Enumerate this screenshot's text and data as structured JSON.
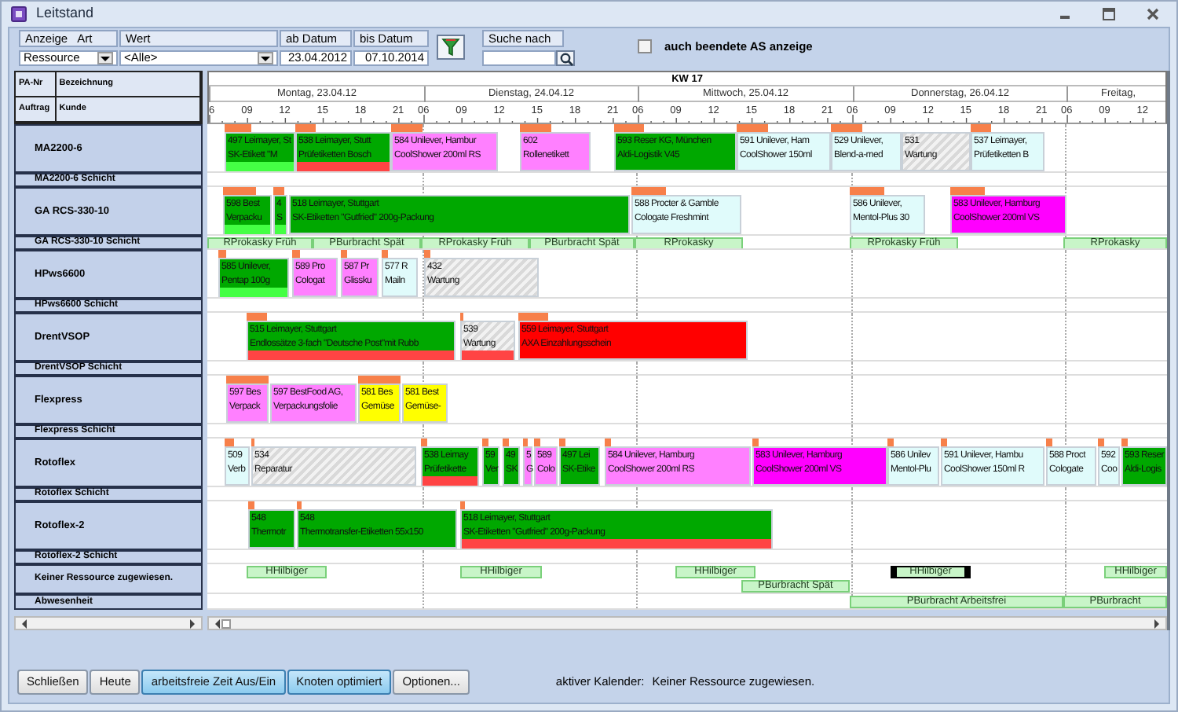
{
  "window": {
    "title": "Leitstand"
  },
  "filters": {
    "display_type": {
      "labels": [
        "Anzeige",
        "Art"
      ],
      "value": "Ressource"
    },
    "value_filter": {
      "label": "Wert",
      "value": "<Alle>"
    },
    "from_date": {
      "label": "ab Datum",
      "value": "23.04.2012"
    },
    "to_date": {
      "label": "bis Datum",
      "value": "07.10.2014"
    },
    "search": {
      "label": "Suche nach"
    },
    "show_finished": {
      "label": "auch beendete AS anzeige",
      "checked": false
    }
  },
  "left_header": [
    [
      "PA-Nr",
      "Bezeichnung"
    ],
    [
      "Auftrag",
      "Kunde"
    ]
  ],
  "timeline": {
    "week": "KW 17",
    "days": [
      {
        "label": "Montag, 23.04.12",
        "hours": [
          "6",
          "09",
          "12",
          "15",
          "18",
          "21"
        ]
      },
      {
        "label": "Dienstag, 24.04.12",
        "hours": [
          "06",
          "09",
          "12",
          "15",
          "18",
          "21"
        ]
      },
      {
        "label": "Mittwoch, 25.04.12",
        "hours": [
          "06",
          "09",
          "12",
          "15",
          "18",
          "21"
        ]
      },
      {
        "label": "Donnerstag, 26.04.12",
        "hours": [
          "06",
          "09",
          "12",
          "15",
          "18",
          "21"
        ]
      },
      {
        "label": "Freitag,",
        "hours": [
          "06",
          "09",
          "12"
        ]
      }
    ]
  },
  "rows": [
    {
      "label": "MA2200-6",
      "kind": "resource",
      "items": [
        {
          "kind": "job",
          "lines": [
            "497 Leimayer, St",
            "SK-Etikett \"M"
          ],
          "color": "#00a800",
          "strip": {
            "color": "#44ff44"
          },
          "setup": true,
          "selected": false
        },
        {
          "kind": "job",
          "lines": [
            "538 Leimayer, Stutt",
            "Prüfetiketten Bosch"
          ],
          "color": "#00a800",
          "strip": {
            "color": "#ff4444"
          },
          "setup": true,
          "selected": false
        },
        {
          "kind": "job",
          "lines": [
            "584 Unilever, Hambur",
            "CoolShower 200ml RS"
          ],
          "color": "#ff80ff",
          "setup": true,
          "selected": false
        },
        {
          "kind": "job",
          "lines": [
            "602",
            "Rollenetikett"
          ],
          "color": "#ff80ff",
          "setup": true,
          "selected": false
        },
        {
          "kind": "job",
          "lines": [
            "593 Reser KG, München",
            "Aldi-Logistik V45"
          ],
          "color": "#00a800",
          "setup": true,
          "selected": false
        },
        {
          "kind": "job",
          "lines": [
            "591 Unilever, Ham",
            "CoolShower 150ml"
          ],
          "color": "#e0fbfb",
          "setup": true,
          "selected": false
        },
        {
          "kind": "job",
          "lines": [
            "529 Unilever,",
            "Blend-a-med"
          ],
          "color": "#e0fbfb",
          "setup": true,
          "selected": false
        },
        {
          "kind": "maintenance",
          "lines": [
            "531",
            "Wartung"
          ],
          "setup": false,
          "selected": false
        },
        {
          "kind": "job",
          "lines": [
            "537 Leimayer,",
            "Prüfetiketten B"
          ],
          "color": "#e0fbfb",
          "setup": true,
          "selected": false
        }
      ]
    },
    {
      "label": "MA2200-6 Schicht",
      "kind": "shift"
    },
    {
      "label": "GA RCS-330-10",
      "kind": "resource",
      "items": [
        {
          "kind": "job",
          "lines": [
            "598 Best",
            "Verpacku"
          ],
          "color": "#00a800",
          "strip": {
            "color": "#44ff44"
          },
          "setup": true,
          "selected": false
        },
        {
          "kind": "job",
          "lines": [
            "4",
            "S"
          ],
          "color": "#00a800",
          "strip": {
            "color": "#44ff44"
          },
          "setup": true,
          "selected": false
        },
        {
          "kind": "job",
          "lines": [
            "518 Leimayer, Stuttgart",
            "SK-Etiketten \"Gutfried\" 200g-Packung"
          ],
          "color": "#00a800",
          "setup": false,
          "selected": false
        },
        {
          "kind": "job",
          "lines": [
            "588 Procter & Gamble",
            "Cologate Freshmint"
          ],
          "color": "#e0fbfb",
          "setup": true,
          "selected": false
        },
        {
          "kind": "job",
          "lines": [
            "586 Unilever,",
            "Mentol-Plus 30"
          ],
          "color": "#e0fbfb",
          "setup": true,
          "selected": false
        },
        {
          "kind": "job",
          "lines": [
            "583 Unilever, Hamburg",
            "CoolShower 200ml VS"
          ],
          "color": "#ff00ff",
          "setup": true,
          "selected": false
        }
      ]
    },
    {
      "label": "GA RCS-330-10 Schicht",
      "kind": "shift",
      "items": [
        {
          "kind": "shift",
          "text": "RProkasky Früh",
          "selected": false
        },
        {
          "kind": "shift",
          "text": "PBurbracht Spät",
          "selected": false
        },
        {
          "kind": "shift",
          "text": "RProkasky Früh",
          "selected": false
        },
        {
          "kind": "shift",
          "text": "PBurbracht Spät",
          "selected": false
        },
        {
          "kind": "shift",
          "text": "RProkasky",
          "selected": false
        },
        {
          "kind": "shift",
          "text": "RProkasky Früh",
          "selected": false
        },
        {
          "kind": "shift",
          "text": "RProkasky",
          "selected": false
        }
      ]
    },
    {
      "label": "HPws6600",
      "kind": "resource",
      "items": [
        {
          "kind": "job",
          "lines": [
            "585 Unilever,",
            "Pentap 100g"
          ],
          "color": "#00a800",
          "strip": {
            "color": "#44ff44"
          },
          "setup": true,
          "selected": false
        },
        {
          "kind": "job",
          "lines": [
            "589 Pro",
            "Cologat"
          ],
          "color": "#ff80ff",
          "setup": true,
          "selected": false
        },
        {
          "kind": "job",
          "lines": [
            "587 Pr",
            "Glissku"
          ],
          "color": "#ff80ff",
          "setup": true,
          "selected": false
        },
        {
          "kind": "job",
          "lines": [
            "577 R",
            "Mailn"
          ],
          "color": "#e0fbfb",
          "setup": true,
          "selected": false
        },
        {
          "kind": "maintenance",
          "lines": [
            "432",
            "Wartung"
          ],
          "setup": true,
          "selected": false
        }
      ]
    },
    {
      "label": "HPws6600 Schicht",
      "kind": "shift"
    },
    {
      "label": "DrentVSOP",
      "kind": "resource",
      "items": [
        {
          "kind": "job",
          "lines": [
            "515 Leimayer, Stuttgart",
            "Endlossätze 3-fach \"Deutsche Post\"mit Rubb"
          ],
          "color": "#00a800",
          "strip": {
            "color": "#ff4444"
          },
          "setup": true,
          "selected": false
        },
        {
          "kind": "maintenance",
          "lines": [
            "539",
            "Wartung"
          ],
          "strip": {
            "color": "#ff4444"
          },
          "setup": true,
          "selected": false
        },
        {
          "kind": "job",
          "lines": [
            "559 Leimayer, Stuttgart",
            "AXA Einzahlungsschein"
          ],
          "color": "#ff0000",
          "setup": true,
          "selected": false
        }
      ]
    },
    {
      "label": "DrentVSOP Schicht",
      "kind": "shift"
    },
    {
      "label": "Flexpress",
      "kind": "resource",
      "items": [
        {
          "kind": "job",
          "lines": [
            "597 Bes",
            "Verpack"
          ],
          "color": "#ff80ff",
          "setup": true,
          "selected": false
        },
        {
          "kind": "job",
          "lines": [
            "597 BestFood AG,",
            "Verpackungsfolie"
          ],
          "color": "#ff80ff",
          "setup": false,
          "selected": false
        },
        {
          "kind": "job",
          "lines": [
            "581 Bes",
            "Gemüse"
          ],
          "color": "#ffff00",
          "setup": true,
          "selected": false
        },
        {
          "kind": "job",
          "lines": [
            "581 Best",
            "Gemüse-"
          ],
          "color": "#ffff00",
          "setup": false,
          "selected": false
        }
      ]
    },
    {
      "label": "Flexpress Schicht",
      "kind": "shift"
    },
    {
      "label": "Rotoflex",
      "kind": "resource",
      "items": [
        {
          "kind": "job",
          "lines": [
            "509",
            "Verb"
          ],
          "color": "#e0fbfb",
          "setup": true,
          "selected": false
        },
        {
          "kind": "maintenance",
          "lines": [
            "534",
            "Reparatur"
          ],
          "setup": true,
          "selected": false
        },
        {
          "kind": "job",
          "lines": [
            "538 Leimay",
            "Prüfetikette"
          ],
          "color": "#00a800",
          "strip": {
            "color": "#ff4444"
          },
          "setup": true,
          "selected": false
        },
        {
          "kind": "job",
          "lines": [
            "59",
            "Ver"
          ],
          "color": "#00a800",
          "setup": true,
          "selected": false
        },
        {
          "kind": "job",
          "lines": [
            "49",
            "SK"
          ],
          "color": "#00a800",
          "setup": true,
          "selected": false
        },
        {
          "kind": "job",
          "lines": [
            "5",
            "G"
          ],
          "color": "#ff80ff",
          "setup": true,
          "selected": false
        },
        {
          "kind": "job",
          "lines": [
            "589",
            "Colo"
          ],
          "color": "#ff80ff",
          "setup": true,
          "selected": false
        },
        {
          "kind": "job",
          "lines": [
            "497 Lei",
            "SK-Etike"
          ],
          "color": "#00a800",
          "setup": true,
          "selected": false
        },
        {
          "kind": "job",
          "lines": [
            "584 Unilever, Hamburg",
            "CoolShower 200ml RS"
          ],
          "color": "#ff80ff",
          "setup": true,
          "selected": false
        },
        {
          "kind": "job",
          "lines": [
            "583 Unilever, Hamburg",
            "CoolShower 200ml VS"
          ],
          "color": "#ff00ff",
          "setup": true,
          "selected": false
        },
        {
          "kind": "job",
          "lines": [
            "586 Unilev",
            "Mentol-Plu"
          ],
          "color": "#e0fbfb",
          "setup": true,
          "selected": false
        },
        {
          "kind": "job",
          "lines": [
            "591 Unilever, Hambu",
            "CoolShower 150ml R"
          ],
          "color": "#e0fbfb",
          "setup": true,
          "selected": false
        },
        {
          "kind": "job",
          "lines": [
            "588 Proct",
            "Cologate"
          ],
          "color": "#e0fbfb",
          "setup": true,
          "selected": false
        },
        {
          "kind": "job",
          "lines": [
            "592",
            "Coo"
          ],
          "color": "#e0fbfb",
          "setup": true,
          "selected": false
        },
        {
          "kind": "job",
          "lines": [
            "593 Reser",
            "Aldi-Logis"
          ],
          "color": "#00a800",
          "setup": true,
          "selected": false
        }
      ]
    },
    {
      "label": "Rotoflex Schicht",
      "kind": "shift"
    },
    {
      "label": "Rotoflex-2",
      "kind": "resource",
      "items": [
        {
          "kind": "job",
          "lines": [
            "548",
            "Thermotr"
          ],
          "color": "#00a800",
          "setup": true,
          "selected": false
        },
        {
          "kind": "job",
          "lines": [
            "548",
            "Thermotransfer-Etiketten 55x150"
          ],
          "color": "#00a800",
          "setup": true,
          "selected": false
        },
        {
          "kind": "job",
          "lines": [
            "518 Leimayer, Stuttgart",
            "SK-Etiketten \"Gutfried\" 200g-Packung"
          ],
          "color": "#00a800",
          "strip": {
            "color": "#ff4444"
          },
          "setup": true,
          "selected": false
        }
      ]
    },
    {
      "label": "Rotoflex-2 Schicht",
      "kind": "shift"
    },
    {
      "label": "Keiner Ressource zugewiesen.",
      "kind": "lanes",
      "lanes": [
        [
          {
            "kind": "shift",
            "text": "HHilbiger",
            "selected": false
          },
          {
            "kind": "shift",
            "text": "HHilbiger",
            "selected": false
          },
          {
            "kind": "shift",
            "text": "HHilbiger",
            "selected": false
          },
          {
            "kind": "shift",
            "text": "HHilbiger",
            "selected": true
          },
          {
            "kind": "shift",
            "text": "HHilbiger",
            "selected": false
          }
        ],
        [
          {
            "kind": "shift",
            "text": "PBurbracht Spät",
            "selected": false
          }
        ]
      ]
    },
    {
      "label": "Abwesenheit",
      "kind": "shift",
      "items": [
        {
          "kind": "shift",
          "text": "PBurbracht Arbeitsfrei",
          "selected": false
        },
        {
          "kind": "shift",
          "text": "PBurbracht",
          "selected": false
        }
      ]
    }
  ],
  "footer": {
    "buttons": [
      {
        "label": "Schließen",
        "pressed": false
      },
      {
        "label": "Heute",
        "pressed": false
      },
      {
        "label": "arbeitsfreie Zeit Aus/Ein",
        "pressed": true
      },
      {
        "label": "Knoten optimiert",
        "pressed": true
      },
      {
        "label": "Optionen...",
        "pressed": false
      }
    ],
    "calendar_label": "aktiver Kalender:",
    "calendar_value": "Keiner Ressource zugewiesen."
  }
}
